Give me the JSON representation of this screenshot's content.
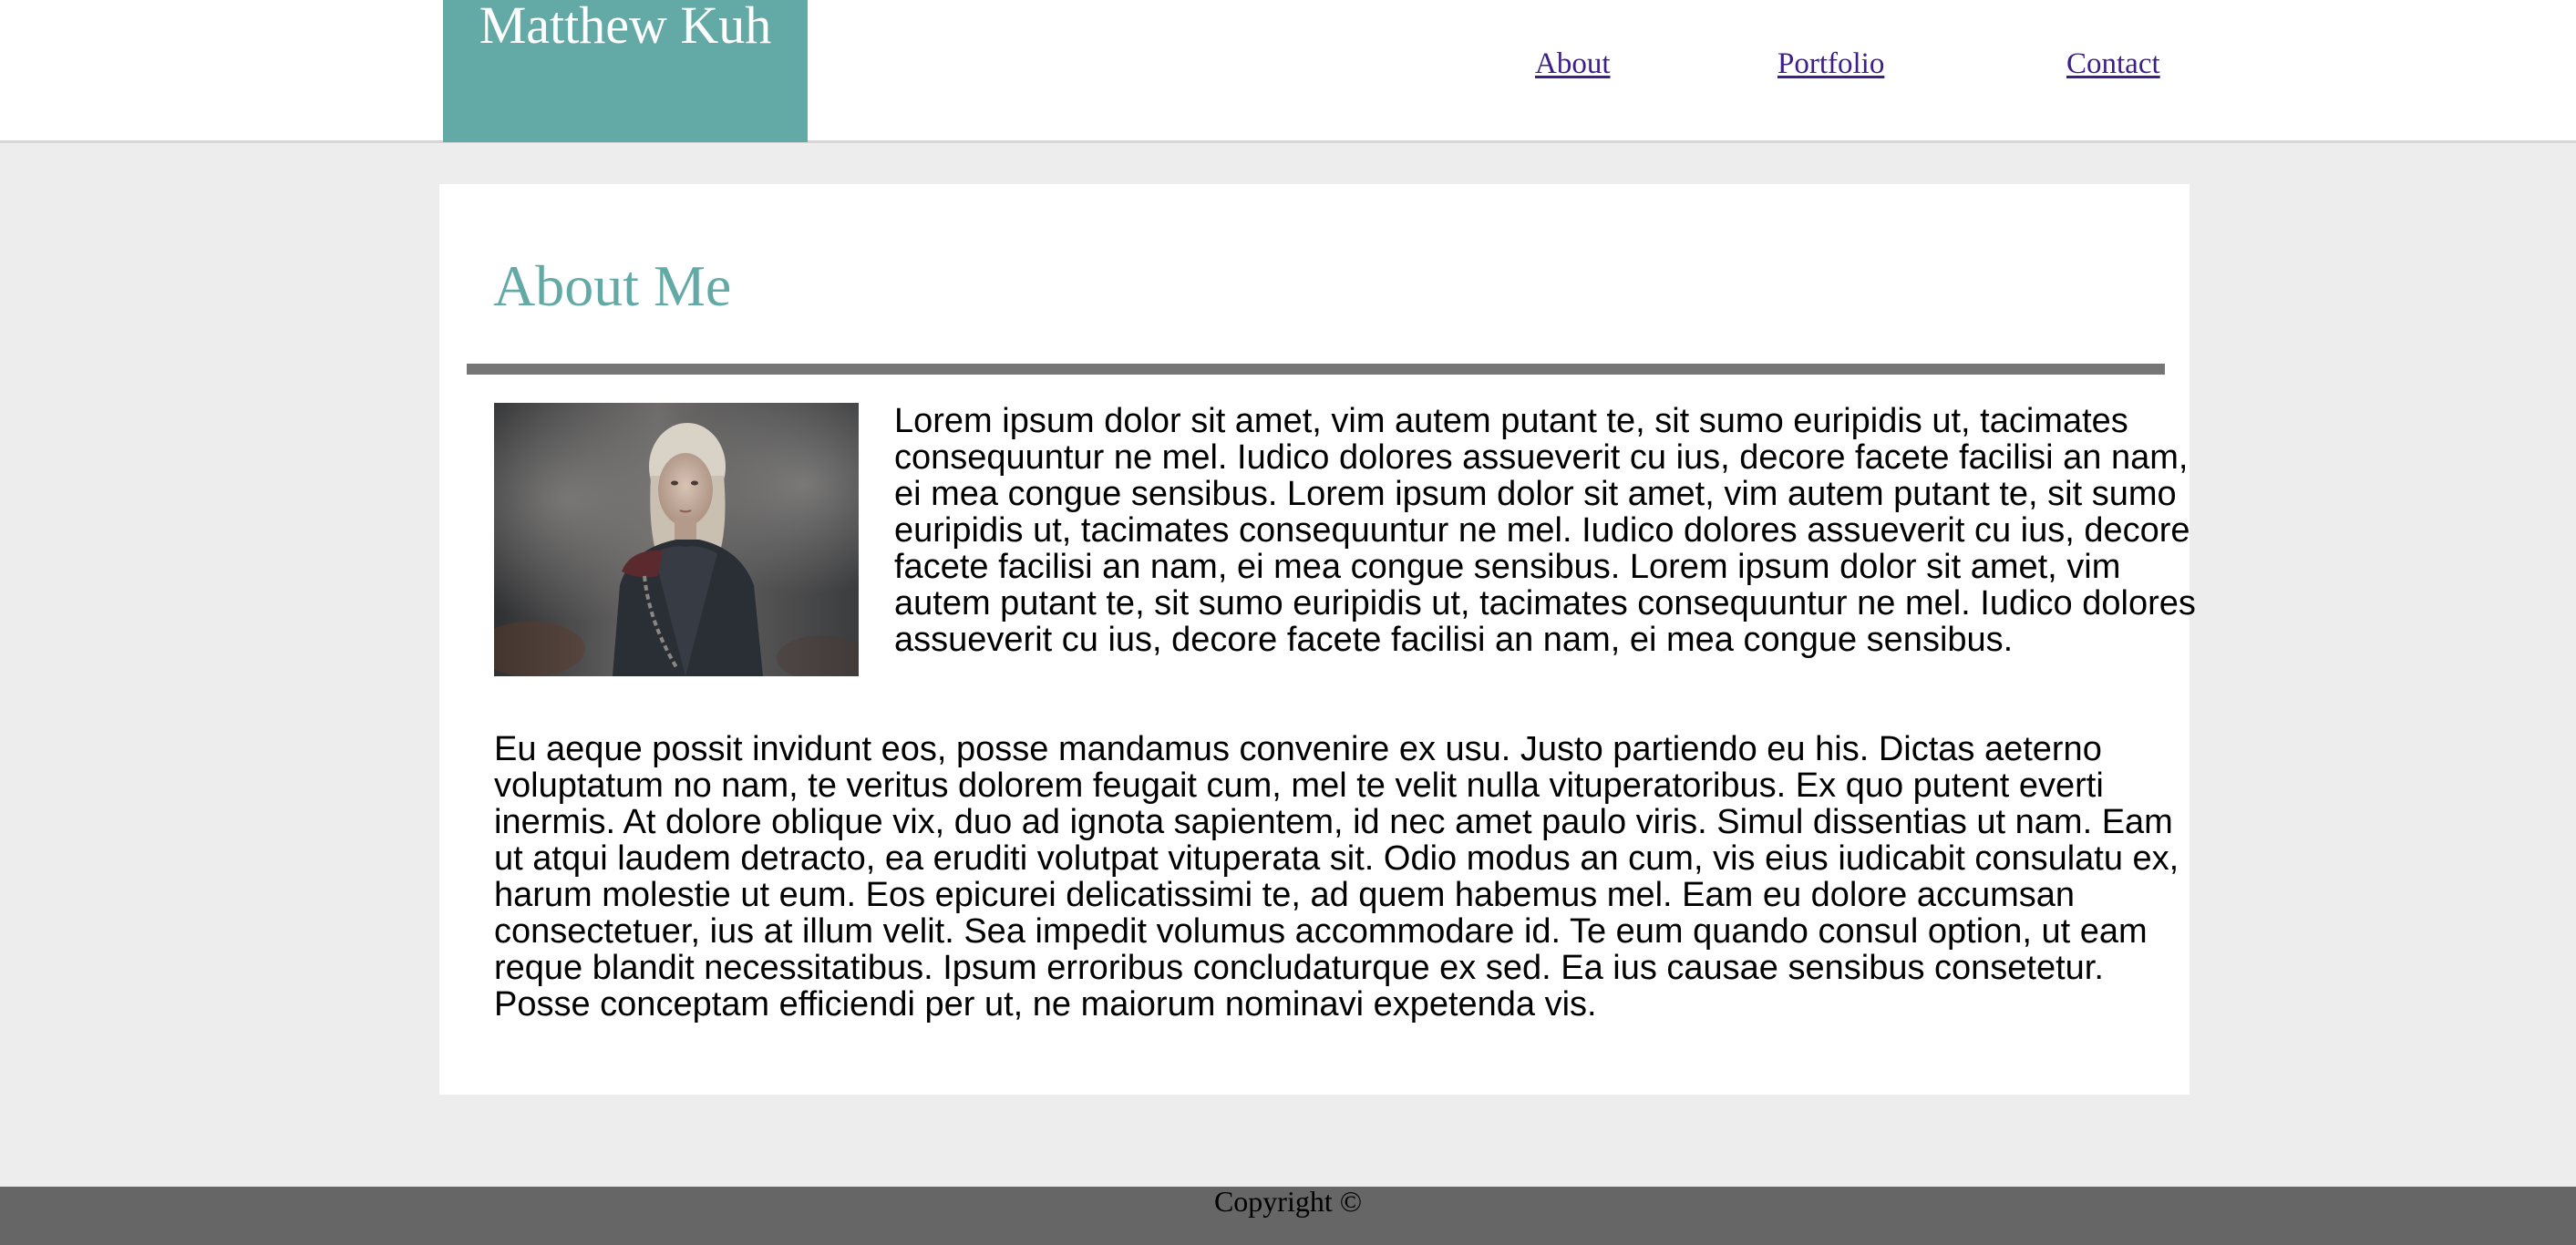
{
  "header": {
    "logo_text": "Matthew Kuh",
    "nav": {
      "about": "About",
      "portfolio": "Portfolio",
      "contact": "Contact"
    }
  },
  "main": {
    "title": "About Me",
    "photo_alt": "portrait photo",
    "paragraphs": [
      "Lorem ipsum dolor sit amet, vim autem putant te, sit sumo euripidis ut, tacimates consequuntur ne mel. Iudico dolores assueverit cu ius, decore facete facilisi an nam, ei mea congue sensibus. Lorem ipsum dolor sit amet, vim autem putant te, sit sumo euripidis ut, tacimates consequuntur ne mel. Iudico dolores assueverit cu ius, decore facete facilisi an nam, ei mea congue sensibus. Lorem ipsum dolor sit amet, vim autem putant te, sit sumo euripidis ut, tacimates consequuntur ne mel. Iudico dolores assueverit cu ius, decore facete facilisi an nam, ei mea congue sensibus.",
      "Eu aeque possit invidunt eos, posse mandamus convenire ex usu. Justo partiendo eu his. Dictas aeterno voluptatum no nam, te veritus dolorem feugait cum, mel te velit nulla vituperatoribus. Ex quo putent everti inermis. At dolore oblique vix, duo ad ignota sapientem, id nec amet paulo viris. Simul dissentias ut nam. Eam ut atqui laudem detracto, ea eruditi volutpat vituperata sit. Odio modus an cum, vis eius iudicabit consulatu ex, harum molestie ut eum. Eos epicurei delicatissimi te, ad quem habemus mel. Eam eu dolore accumsan consectetuer, ius at illum velit. Sea impedit volumus accommodare id. Te eum quando consul option, ut eam reque blandit necessitatibus. Ipsum erroribus concludaturque ex sed. Ea ius causae sensibus consetetur. Posse conceptam efficiendi per ut, ne maiorum nominavi expetenda vis."
    ]
  },
  "footer": {
    "copyright": "Copyright ©"
  },
  "colors": {
    "accent": "#63aaa6",
    "link": "#3c1f8b",
    "page_background": "#ededed",
    "divider": "#767676",
    "footer_background": "#666666"
  }
}
